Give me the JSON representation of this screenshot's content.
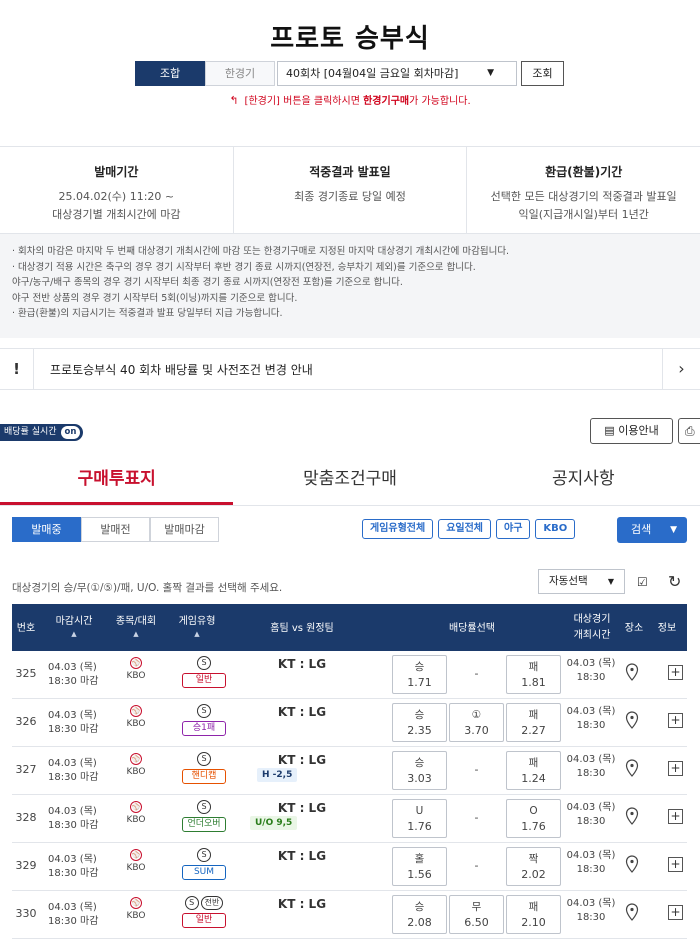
{
  "page": {
    "title": "프로토 승부식",
    "mode_tabs": [
      "조합",
      "한경기"
    ],
    "round_select": "40회차 [04월04일 금요일 회차마감]",
    "query_button": "조회",
    "hint_prefix": "[한경기] 버튼을 클릭하시면 ",
    "hint_strong": "한경기구매",
    "hint_suffix": "가 가능합니다."
  },
  "info": [
    {
      "title": "발매기간",
      "lines": [
        "25.04.02(수) 11:20 ~",
        "대상경기별 개최시간에 마감"
      ]
    },
    {
      "title": "적중결과 발표일",
      "lines": [
        "최종 경기종료 당일 예정",
        ""
      ]
    },
    {
      "title": "환급(환불)기간",
      "lines": [
        "선택한 모든 대상경기의 적중결과 발표일",
        "익일(지급개시일)부터 1년간"
      ]
    }
  ],
  "notes": [
    "· 회차의 마감은 마지막 두 번째 대상경기 개최시간에 마감 또는 한경기구매로 지정된 마지막 대상경기 개최시간에 마감됩니다.",
    "· 대상경기 적용 시간은 축구의 경우 경기 시작부터 후반 경기 종료 시까지(연장전, 승부차기 제외)를 기준으로 합니다.",
    "   야구/농구/배구 종목의 경우 경기 시작부터 최종 경기 종료 시까지(연장전 포함)를 기준으로 합니다.",
    "   야구 전반 상품의 경우 경기 시작부터 5회(이닝)까지를 기준으로 합니다.",
    "· 환급(환불)의 지급시기는 적중결과 발표 당일부터 지급 가능합니다."
  ],
  "notice": {
    "icon": "!",
    "text": "프로토승부식 40 회차 배당률 및 사전조건 변경 안내",
    "arrow": "›"
  },
  "live": {
    "label": "배당률 실시간",
    "toggle": "on"
  },
  "guide_button": "이용안내",
  "tabs": [
    "구매투표지",
    "맞춤조건구매",
    "공지사항"
  ],
  "state_tabs": [
    "발매중",
    "발매전",
    "발매마감"
  ],
  "filters": [
    "게임유형전체",
    "요일전체",
    "야구",
    "KBO"
  ],
  "search_button": "검색",
  "select_guide": "대상경기의 승/무(①/⑤)/패, U/O. 홀짝 결과를 선택해 주세요.",
  "auto_select": "자동선택",
  "columns": {
    "no": "번호",
    "deadline": "마감시간",
    "sport": "종목/대회",
    "gametype": "게임유형",
    "match": "홈팀 vs 원정팀",
    "odds": "배당률선택",
    "start_top": "대상경기",
    "start_bottom": "개최시간",
    "venue": "장소",
    "info": "정보",
    "sort": "▲"
  },
  "rows": [
    {
      "no": "325",
      "date": "04.03 (목)",
      "time": "18:30 마감",
      "league": "KBO",
      "type": "일반",
      "type_color": "#c8102e",
      "match": "KT : LG",
      "cond": "",
      "o1l": "승",
      "o1v": "1.71",
      "o2l": "",
      "o2v": "-",
      "o3l": "패",
      "o3v": "1.81",
      "sd": "04.03 (목)",
      "st": "18:30"
    },
    {
      "no": "326",
      "date": "04.03 (목)",
      "time": "18:30 마감",
      "league": "KBO",
      "type": "승1패",
      "type_color": "#8e24aa",
      "match": "KT : LG",
      "cond": "",
      "o1l": "승",
      "o1v": "2.35",
      "o2l": "①",
      "o2v": "3.70",
      "o3l": "패",
      "o3v": "2.27",
      "sd": "04.03 (목)",
      "st": "18:30"
    },
    {
      "no": "327",
      "date": "04.03 (목)",
      "time": "18:30 마감",
      "league": "KBO",
      "type": "핸디캡",
      "type_color": "#e65100",
      "match": "KT : LG",
      "cond": "H -2,5",
      "o1l": "승",
      "o1v": "3.03",
      "o2l": "",
      "o2v": "-",
      "o3l": "패",
      "o3v": "1.24",
      "sd": "04.03 (목)",
      "st": "18:30"
    },
    {
      "no": "328",
      "date": "04.03 (목)",
      "time": "18:30 마감",
      "league": "KBO",
      "type": "언더오버",
      "type_color": "#2e7d32",
      "match": "KT : LG",
      "cond": "U/O 9,5",
      "o1l": "U",
      "o1v": "1.76",
      "o2l": "",
      "o2v": "-",
      "o3l": "O",
      "o3v": "1.76",
      "sd": "04.03 (목)",
      "st": "18:30"
    },
    {
      "no": "329",
      "date": "04.03 (목)",
      "time": "18:30 마감",
      "league": "KBO",
      "type": "SUM",
      "type_color": "#1565c0",
      "match": "KT : LG",
      "cond": "",
      "o1l": "홀",
      "o1v": "1.56",
      "o2l": "",
      "o2v": "-",
      "o3l": "짝",
      "o3v": "2.02",
      "sd": "04.03 (목)",
      "st": "18:30"
    },
    {
      "no": "330",
      "date": "04.03 (목)",
      "time": "18:30 마감",
      "league": "KBO",
      "type": "일반",
      "type_color": "#c8102e",
      "half": "전반",
      "match": "KT : LG",
      "cond": "",
      "o1l": "승",
      "o1v": "2.08",
      "o2l": "무",
      "o2v": "6.50",
      "o3l": "패",
      "o3v": "2.10",
      "sd": "04.03 (목)",
      "st": "18:30"
    }
  ]
}
